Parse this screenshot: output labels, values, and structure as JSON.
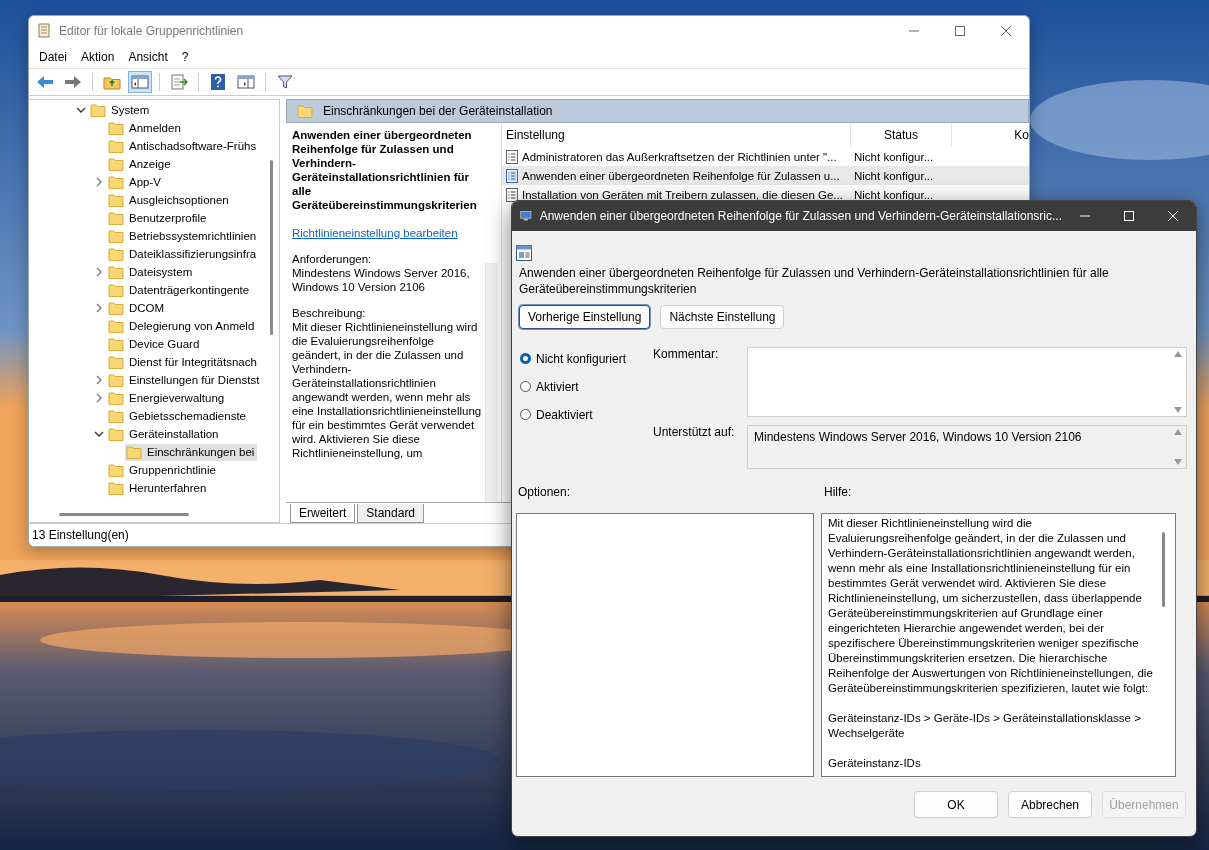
{
  "main_window": {
    "title": "Editor für lokale Gruppenrichtlinien",
    "menu": [
      "Datei",
      "Aktion",
      "Ansicht",
      "?"
    ],
    "toolbar": [
      {
        "kind": "back",
        "pressed": false
      },
      {
        "kind": "forward",
        "pressed": false
      },
      {
        "kind": "up",
        "pressed": false
      },
      {
        "kind": "tree",
        "pressed": true
      },
      {
        "kind": "export",
        "pressed": false
      },
      {
        "kind": "help",
        "pressed": false
      },
      {
        "kind": "pane",
        "pressed": false
      },
      {
        "kind": "filter",
        "pressed": false
      }
    ],
    "tree": [
      {
        "label": "System",
        "expanded": true,
        "selected": false,
        "children": [
          {
            "label": "Anmelden",
            "selected": false
          },
          {
            "label": "Antischadsoftware-Frühs",
            "selected": false
          },
          {
            "label": "Anzeige",
            "selected": false
          },
          {
            "label": "App-V",
            "expanded": false,
            "selected": false
          },
          {
            "label": "Ausgleichsoptionen",
            "selected": false
          },
          {
            "label": "Benutzerprofile",
            "selected": false
          },
          {
            "label": "Betriebssystemrichtlinien",
            "selected": false
          },
          {
            "label": "Dateiklassifizierungsinfra",
            "selected": false
          },
          {
            "label": "Dateisystem",
            "expanded": false,
            "selected": false
          },
          {
            "label": "Datenträgerkontingente",
            "selected": false
          },
          {
            "label": "DCOM",
            "expanded": false,
            "selected": false
          },
          {
            "label": "Delegierung von Anmeld",
            "selected": false
          },
          {
            "label": "Device Guard",
            "selected": false
          },
          {
            "label": "Dienst für Integritätsnach",
            "selected": false
          },
          {
            "label": "Einstellungen für Dienstst",
            "expanded": false,
            "selected": false
          },
          {
            "label": "Energieverwaltung",
            "expanded": false,
            "selected": false
          },
          {
            "label": "Gebietsschemadienste",
            "selected": false
          },
          {
            "label": "Geräteinstallation",
            "expanded": true,
            "selected": false,
            "children": [
              {
                "label": "Einschränkungen bei",
                "selected": true
              }
            ]
          },
          {
            "label": "Gruppenrichtlinie",
            "selected": false
          },
          {
            "label": "Herunterfahren",
            "selected": false
          }
        ]
      }
    ],
    "details_header": "Einschränkungen bei der Geräteinstallation",
    "description": {
      "title": "Anwenden einer übergeordneten Reihenfolge für Zulassen und Verhindern-Geräteinstallationsrichtlinien für alle Geräteübereinstimmungskriterien",
      "link": "Richtlinieneinstellung bearbeiten",
      "requirements_label": "Anforderungen:",
      "requirements": "Mindestens Windows Server 2016, Windows 10 Version 2106",
      "description_label": "Beschreibung:",
      "description": "Mit dieser Richtlinieneinstellung wird die Evaluierungsreihenfolge geändert, in der die Zulassen und Verhindern-Geräteinstallationsrichtlinien angewandt werden, wenn mehr als eine Installationsrichtlinieneinstellung für ein bestimmtes Gerät verwendet wird. Aktivieren Sie diese Richtlinieneinstellung, um"
    },
    "view_tabs": [
      {
        "label": "Erweitert",
        "selected": true
      },
      {
        "label": "Standard",
        "selected": false
      }
    ],
    "list": {
      "columns": [
        "Einstellung",
        "Status",
        "Ko"
      ],
      "rows": [
        {
          "setting": "Administratoren das Außerkraftsetzen der Richtlinien unter \"...",
          "status": "Nicht konfigur...",
          "selected": false
        },
        {
          "setting": "Anwenden einer übergeordneten Reihenfolge für Zulassen u...",
          "status": "Nicht konfigur...",
          "selected": true
        },
        {
          "setting": "Installation von Geräten mit Treibern zulassen, die diesen Ge...",
          "status": "Nicht konfigur...",
          "selected": false
        }
      ]
    },
    "status_bar": "13 Einstellung(en)"
  },
  "dialog": {
    "title": "Anwenden einer übergeordneten Reihenfolge für Zulassen und Verhindern-Geräteinstallationsric...",
    "policy_name": "Anwenden einer übergeordneten Reihenfolge für Zulassen und Verhindern-Geräteinstallationsrichtlinien für alle Geräteübereinstimmungskriterien",
    "nav_buttons": [
      {
        "label": "Vorherige Einstellung",
        "focused": true
      },
      {
        "label": "Nächste Einstellung",
        "focused": false
      }
    ],
    "states": [
      {
        "label": "Nicht konfiguriert",
        "selected": true
      },
      {
        "label": "Aktiviert",
        "selected": false
      },
      {
        "label": "Deaktiviert",
        "selected": false
      }
    ],
    "comment_label": "Kommentar:",
    "supported_label": "Unterstützt auf:",
    "supported": "Mindestens Windows Server 2016, Windows 10 Version 2106",
    "options_label": "Optionen:",
    "help_label": "Hilfe:",
    "help": [
      "Mit dieser Richtlinieneinstellung wird die Evaluierungsreihenfolge geändert, in der die Zulassen und Verhindern-Geräteinstallationsrichtlinien angewandt werden, wenn mehr als eine Installationsrichtlinieneinstellung für ein bestimmtes Gerät verwendet wird. Aktivieren Sie diese Richtlinieneinstellung, um sicherzustellen, dass überlappende Geräteübereinstimmungskriterien auf Grundlage einer eingerichteten Hierarchie angewendet werden, bei der spezifischere Übereinstimmungskriterien weniger spezifische Übereinstimmungskriterien ersetzen. Die hierarchische Reihenfolge der Auswertungen von Richtlinieneinstellungen, die Geräteübereinstimmungskriterien spezifizieren, lautet wie folgt:",
      "Geräteinstanz-IDs > Geräte-IDs > Geräteinstallationsklasse > Wechselgeräte",
      "Geräteinstanz-IDs"
    ],
    "footer_buttons": [
      {
        "label": "OK",
        "disabled": false
      },
      {
        "label": "Abbrechen",
        "disabled": false
      },
      {
        "label": "Übernehmen",
        "disabled": true
      }
    ]
  }
}
